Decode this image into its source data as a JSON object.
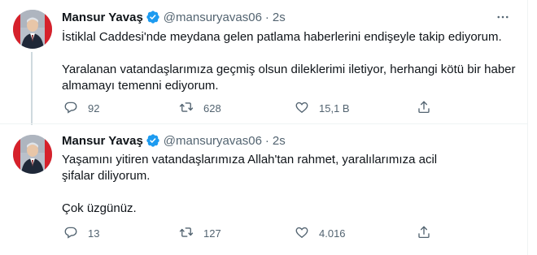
{
  "tweets": [
    {
      "author": {
        "name": "Mansur Yavaş",
        "handle": "@mansuryavas06",
        "time": "2s",
        "verified": true
      },
      "paragraphs": [
        "İstiklal Caddesi'nde meydana gelen patlama haberlerini endişeyle takip ediyorum.",
        "Yaralanan vatandaşlarımıza geçmiş olsun dileklerimi iletiyor, herhangi kötü bir haber almamayı temenni ediyorum."
      ],
      "stats": {
        "replies": "92",
        "retweets": "628",
        "likes": "15,1 B"
      }
    },
    {
      "author": {
        "name": "Mansur Yavaş",
        "handle": "@mansuryavas06",
        "time": "2s",
        "verified": true
      },
      "paragraphs": [
        "Yaşamını yitiren vatandaşlarımıza Allah'tan rahmet, yaralılarımıza acil şifalar diliyorum.",
        "Çok üzgünüz."
      ],
      "stats": {
        "replies": "13",
        "retweets": "127",
        "likes": "4.016"
      }
    }
  ],
  "icons": {
    "verified": "verified-badge-icon",
    "more": "more-options-icon",
    "reply": "reply-icon",
    "retweet": "retweet-icon",
    "like": "like-icon",
    "share": "share-icon"
  },
  "colors": {
    "verified": "#1d9bf0",
    "text": "#0f1419",
    "secondary": "#536471",
    "thread_line": "#cfd9de",
    "divider": "#eff3f4"
  }
}
